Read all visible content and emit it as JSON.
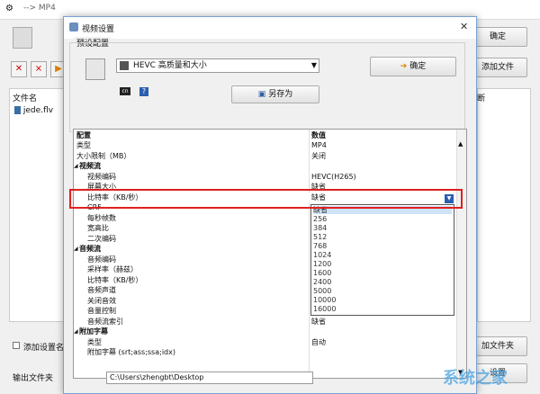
{
  "window": {
    "title": "--> MP4"
  },
  "main": {
    "ok_label": "确定",
    "add_file_label": "添加文件",
    "add_folder_label": "加文件夹",
    "settings_label": "设置",
    "column_filename": "文件名",
    "column_right": "断",
    "file_name": "jede.flv",
    "add_setting_name_label": "添加设置名",
    "output_folder_label": "输出文件夹",
    "output_folder_value": "C:\\Users\\zhengbt\\Desktop"
  },
  "dialog": {
    "title": "视频设置",
    "preset_group_label": "预设配置",
    "preset_selected": "HEVC 高质量和大小",
    "ok_label": "确定",
    "save_as_label": "另存为",
    "header_config": "配置",
    "header_value": "数值",
    "rows": [
      {
        "name": "类型",
        "value": "MP4",
        "indent": 0
      },
      {
        "name": "大小限制（MB）",
        "value": "关闭",
        "indent": 0
      },
      {
        "name": "视频流",
        "value": "",
        "indent": 0,
        "section": true
      },
      {
        "name": "视频编码",
        "value": "HEVC(H265)",
        "indent": 1
      },
      {
        "name": "屏幕大小",
        "value": "缺省",
        "indent": 1
      },
      {
        "name": "比特率（KB/秒）",
        "value": "缺省",
        "indent": 1
      },
      {
        "name": "CRF",
        "value": "",
        "indent": 1
      },
      {
        "name": "每秒帧数",
        "value": "",
        "indent": 1
      },
      {
        "name": "宽高比",
        "value": "",
        "indent": 1
      },
      {
        "name": "二次编码",
        "value": "",
        "indent": 1
      },
      {
        "name": "音频流",
        "value": "",
        "indent": 0,
        "section": true
      },
      {
        "name": "音频编码",
        "value": "",
        "indent": 1
      },
      {
        "name": "采样率（赫兹）",
        "value": "",
        "indent": 1
      },
      {
        "name": "比特率（KB/秒）",
        "value": "",
        "indent": 1
      },
      {
        "name": "音频声道",
        "value": "",
        "indent": 1
      },
      {
        "name": "关闭音效",
        "value": "",
        "indent": 1
      },
      {
        "name": "音量控制",
        "value": "",
        "indent": 1
      },
      {
        "name": "音频流索引",
        "value": "缺省",
        "indent": 1
      },
      {
        "name": "附加字幕",
        "value": "",
        "indent": 0,
        "section": true
      },
      {
        "name": "类型",
        "value": "自动",
        "indent": 1
      },
      {
        "name": "附加字幕 (srt;ass;ssa;idx)",
        "value": "",
        "indent": 1
      }
    ],
    "dropdown_options": [
      "缺省",
      "256",
      "384",
      "512",
      "768",
      "1024",
      "1200",
      "1600",
      "2400",
      "5000",
      "10000",
      "16000"
    ]
  },
  "watermark": "系统之家"
}
